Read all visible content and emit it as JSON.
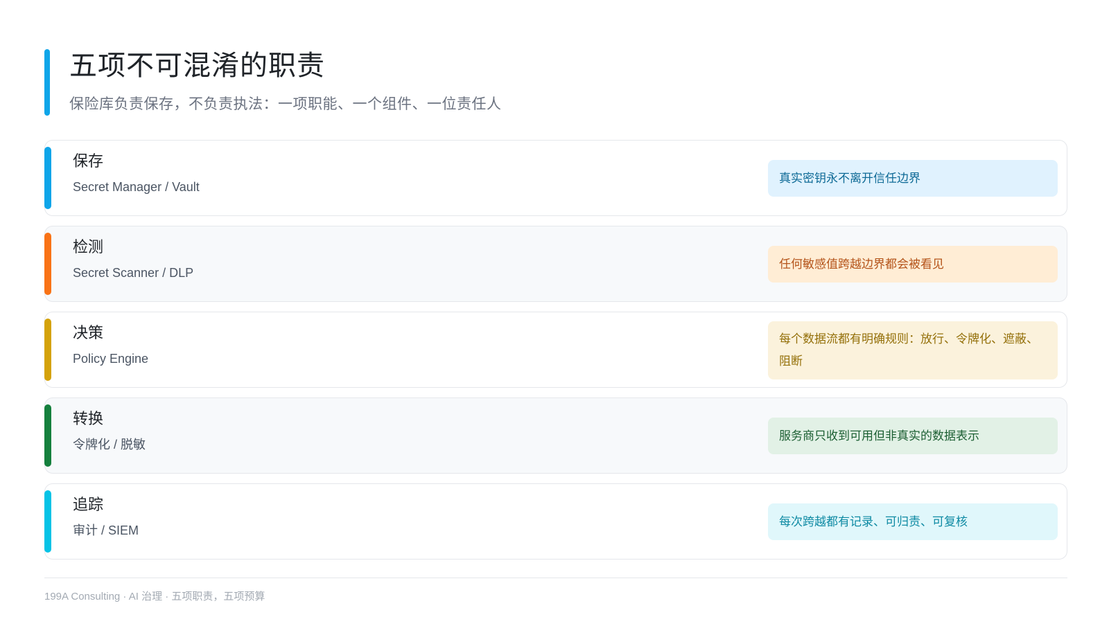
{
  "header": {
    "title": "五项不可混淆的职责",
    "subtitle": "保险库负责保存，不负责执法：一项职能、一个组件、一位责任人"
  },
  "rows": [
    {
      "name": "保存",
      "tool": "Secret Manager / Vault",
      "note": "真实密钥永不离开信任边界",
      "accent": "#0ea5e9",
      "note_bg": "#e0f2fe",
      "note_color": "#0e6a96"
    },
    {
      "name": "检测",
      "tool": "Secret Scanner / DLP",
      "note": "任何敏感值跨越边界都会被看见",
      "accent": "#f97316",
      "note_bg": "#ffedd5",
      "note_color": "#b4541a"
    },
    {
      "name": "决策",
      "tool": "Policy Engine",
      "note": "每个数据流都有明确规则：放行、令牌化、遮蔽、阻断",
      "accent": "#d4a20a",
      "note_bg": "#fbf2dc",
      "note_color": "#94700a"
    },
    {
      "name": "转换",
      "tool": "令牌化 / 脱敏",
      "note": "服务商只收到可用但非真实的数据表示",
      "accent": "#15803d",
      "note_bg": "#e2f1e6",
      "note_color": "#1c5f33"
    },
    {
      "name": "追踪",
      "tool": "审计 / SIEM",
      "note": "每次跨越都有记录、可归责、可复核",
      "accent": "#06c3e6",
      "note_bg": "#e0f7fb",
      "note_color": "#0e8aa3"
    }
  ],
  "footer": {
    "text": "199A Consulting · AI 治理 · 五项职责，五项预算"
  }
}
